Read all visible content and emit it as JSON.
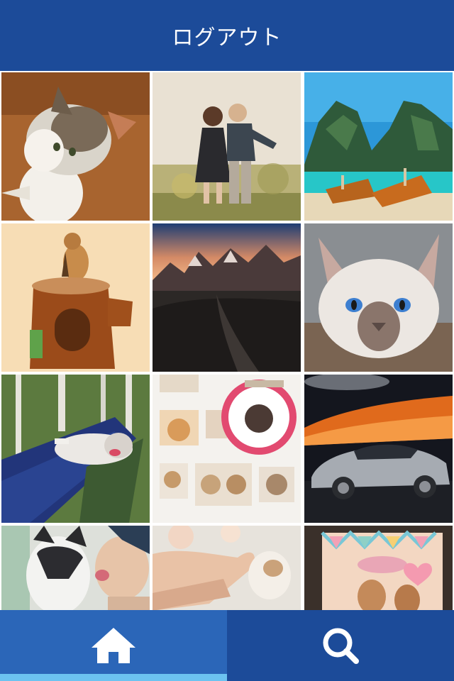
{
  "header": {
    "title": "ログアウト"
  },
  "grid": {
    "photos": [
      {
        "subject": "calico-cat-on-wood-floor"
      },
      {
        "subject": "two-children-kissing-in-field"
      },
      {
        "subject": "longtail-boats-on-tropical-beach"
      },
      {
        "subject": "chipmunk-on-stump-toy-house"
      },
      {
        "subject": "dark-mountains-and-black-sand-dunes"
      },
      {
        "subject": "siamese-cat-with-blue-eyes"
      },
      {
        "subject": "husky-in-hammock-in-birch-forest"
      },
      {
        "subject": "catalog-page-with-cats-and-pink-circle"
      },
      {
        "subject": "silver-coupe-car-under-orange-lights"
      },
      {
        "subject": "husky-kissing-woman"
      },
      {
        "subject": "hand-holding-hamster"
      },
      {
        "subject": "chipmunks-with-bunting-flags"
      }
    ]
  },
  "tabbar": {
    "tabs": [
      {
        "name": "home",
        "icon": "home-icon",
        "active": true
      },
      {
        "name": "search",
        "icon": "search-icon",
        "active": false
      }
    ]
  },
  "colors": {
    "header_bg": "#1c4b99",
    "tab_active_bg": "#2b66b8",
    "tab_inactive_bg": "#1c4b99",
    "tab_indicator": "#6cc3f0"
  }
}
